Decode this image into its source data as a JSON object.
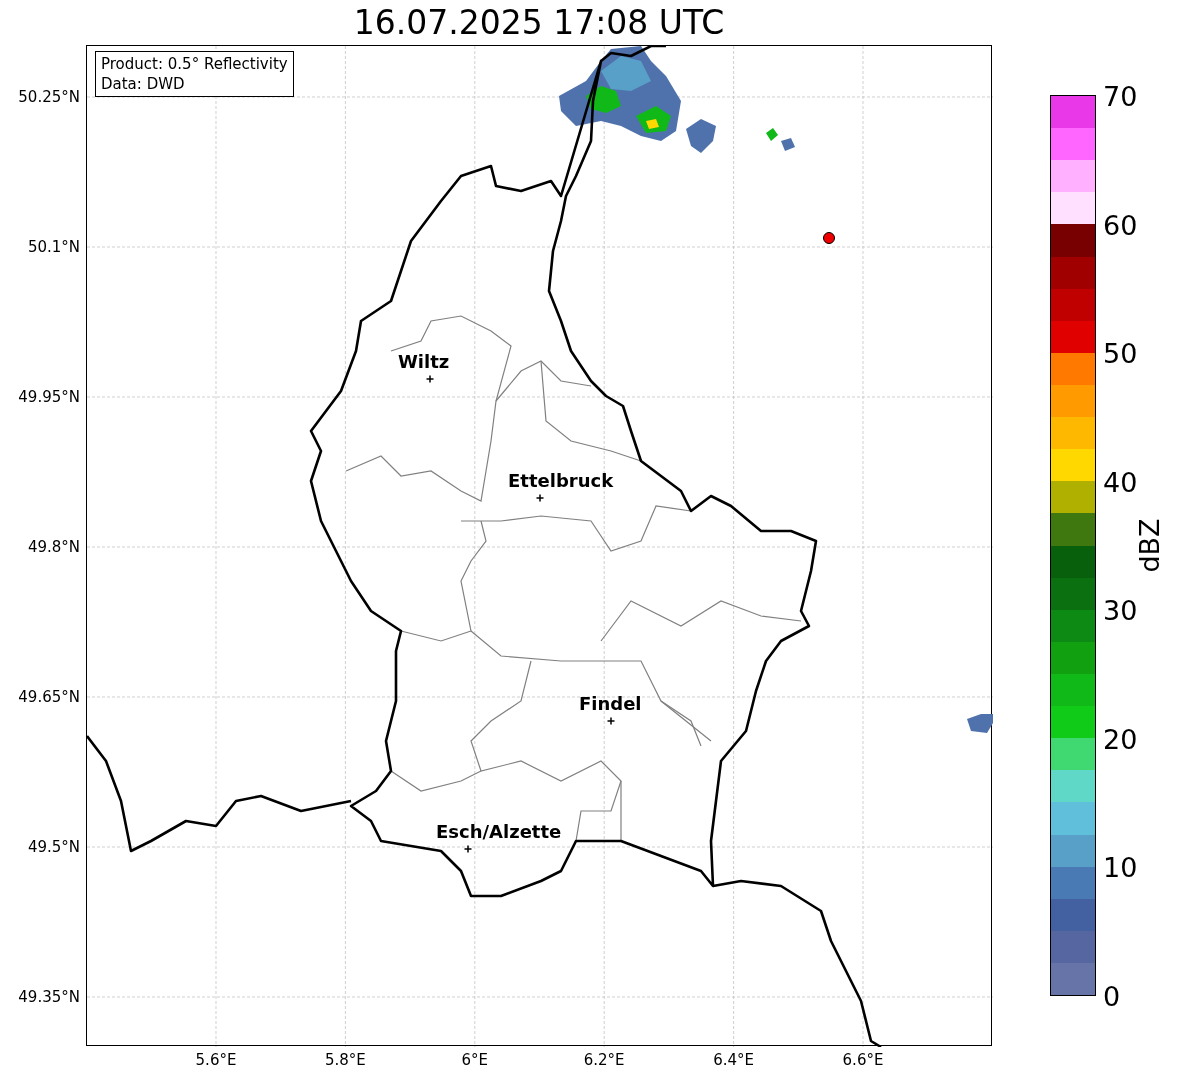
{
  "title": "16.07.2025 17:08 UTC",
  "map": {
    "info_box": [
      "Product: 0.5° Reflectivity",
      "Data: DWD"
    ],
    "y_ticks": [
      "50.25°N",
      "50.1°N",
      "49.95°N",
      "49.8°N",
      "49.65°N",
      "49.5°N",
      "49.35°N"
    ],
    "x_ticks": [
      "5.6°E",
      "5.8°E",
      "6°E",
      "6.2°E",
      "6.4°E",
      "6.6°E"
    ],
    "cities": [
      "Wiltz",
      "Ettelbruck",
      "Findel",
      "Esch/Alzette"
    ]
  },
  "colorbar": {
    "label": "dBZ",
    "ticks": [
      "70",
      "60",
      "50",
      "40",
      "30",
      "20",
      "10",
      "0"
    ],
    "bins": [
      {
        "color": "#e838e8"
      },
      {
        "color": "#ff66ff"
      },
      {
        "color": "#ffb0ff"
      },
      {
        "color": "#ffe0ff"
      },
      {
        "color": "#780000"
      },
      {
        "color": "#a00000"
      },
      {
        "color": "#c00000"
      },
      {
        "color": "#e00000"
      },
      {
        "color": "#ff7800"
      },
      {
        "color": "#ff9a00"
      },
      {
        "color": "#ffb800"
      },
      {
        "color": "#ffd800"
      },
      {
        "color": "#b0b000"
      },
      {
        "color": "#407810"
      },
      {
        "color": "#08600c"
      },
      {
        "color": "#0a7010"
      },
      {
        "color": "#0c8a14"
      },
      {
        "color": "#10a010"
      },
      {
        "color": "#10b818"
      },
      {
        "color": "#10cc18"
      },
      {
        "color": "#40d870"
      },
      {
        "color": "#60d8c8"
      },
      {
        "color": "#60c0dc"
      },
      {
        "color": "#58a0c8"
      },
      {
        "color": "#4a7ab4"
      },
      {
        "color": "#4360a0"
      },
      {
        "color": "#5566a0"
      },
      {
        "color": "#6674a8"
      }
    ]
  }
}
